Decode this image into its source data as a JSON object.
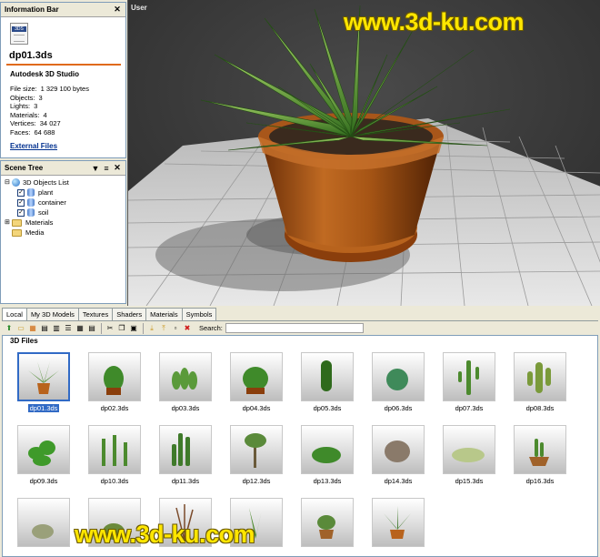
{
  "info_bar": {
    "title": "Information Bar",
    "file_tag": "3DS",
    "file_name": "dp01.3ds",
    "app_name": "Autodesk 3D Studio",
    "rows": [
      {
        "label": "File size:",
        "value": "1 329 100 bytes"
      },
      {
        "label": "Objects:",
        "value": "3"
      },
      {
        "label": "Lights:",
        "value": "3"
      },
      {
        "label": "Materials:",
        "value": "4"
      },
      {
        "label": "Vertices:",
        "value": "34 027"
      },
      {
        "label": "Faces:",
        "value": "64 688"
      }
    ],
    "external_files": "External Files"
  },
  "scene_tree": {
    "title": "Scene Tree",
    "root": "3D Objects List",
    "objects": [
      "plant",
      "container",
      "soil"
    ],
    "folders": [
      "Materials",
      "Media"
    ]
  },
  "viewport": {
    "label": "User"
  },
  "browser": {
    "tabs": [
      "Local",
      "My 3D Models",
      "Textures",
      "Shaders",
      "Materials",
      "Symbols"
    ],
    "active_tab": "Local",
    "search_label": "Search:",
    "search_value": "",
    "files_header": "3D Files",
    "files": [
      "dp01.3ds",
      "dp02.3ds",
      "dp03.3ds",
      "dp04.3ds",
      "dp05.3ds",
      "dp06.3ds",
      "dp07.3ds",
      "dp08.3ds",
      "dp09.3ds",
      "dp10.3ds",
      "dp11.3ds",
      "dp12.3ds",
      "dp13.3ds",
      "dp14.3ds",
      "dp15.3ds",
      "dp16.3ds"
    ],
    "selected_file": "dp01.3ds"
  },
  "watermark": "www.3d-ku.com",
  "colors": {
    "accent_orange": "#e06a1c",
    "selection_blue": "#316ac5",
    "watermark_yellow": "#ffe600",
    "viewport_bg": "#3a3a3a",
    "pot": "#b8631d",
    "plant": "#4c8a2e"
  },
  "icons": {
    "toolbar": [
      "folder-up-icon",
      "new-folder-icon",
      "view-large-icon",
      "view-medium-icon",
      "view-small-icon",
      "view-list-icon",
      "view-details-icon",
      "view-table-icon",
      "cut-icon",
      "copy-icon",
      "paste-icon",
      "import-icon",
      "export-icon",
      "save-icon",
      "delete-icon"
    ]
  }
}
